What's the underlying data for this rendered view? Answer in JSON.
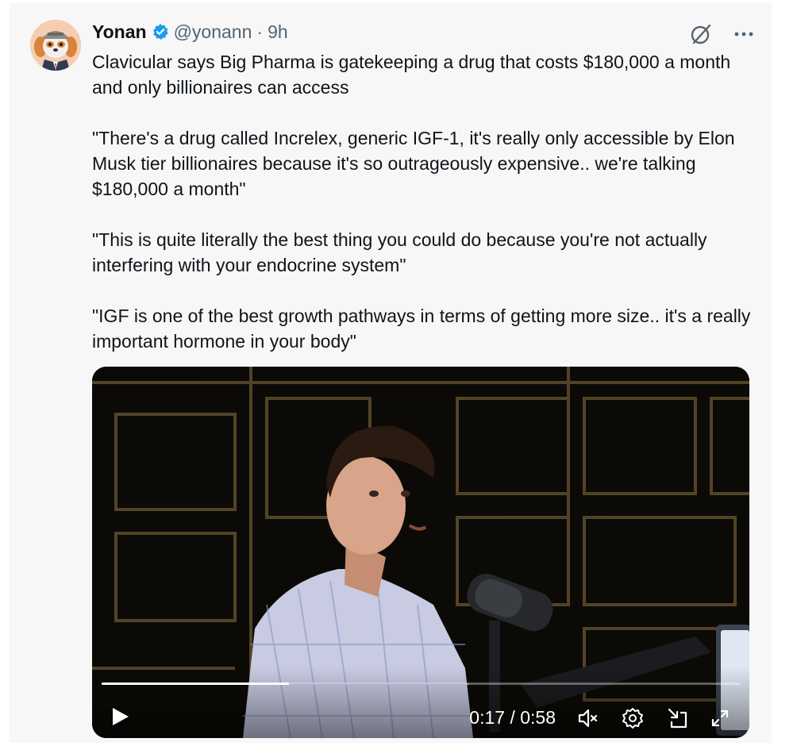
{
  "tweet": {
    "author_name": "Yonan",
    "handle": "@yonann",
    "separator": "·",
    "time": "9h",
    "verified_color": "#1d9bf0",
    "paragraphs": [
      "Clavicular says Big Pharma is gatekeeping a drug that costs $180,000 a month and only billionaires can access",
      "\"There's a drug called Increlex, generic IGF-1, it's really only accessible by Elon Musk tier billionaires because it's so outrageously expensive.. we're talking $180,000 a month\"",
      "\"This is quite literally the best thing you could do because you're not actually interfering with your endocrine system\"",
      "\"IGF is one of the best growth pathways in terms of getting more size.. it's a really important hormone in your body\""
    ],
    "icons": {
      "grok": "grok-icon",
      "more": "more-options-icon"
    }
  },
  "video": {
    "current_time": "0:17",
    "duration": "0:58",
    "time_display": "0:17 / 0:58",
    "progress_fraction": 0.293,
    "controls": [
      "play-icon",
      "mute-icon",
      "settings-icon",
      "pip-icon",
      "fullscreen-icon"
    ]
  }
}
